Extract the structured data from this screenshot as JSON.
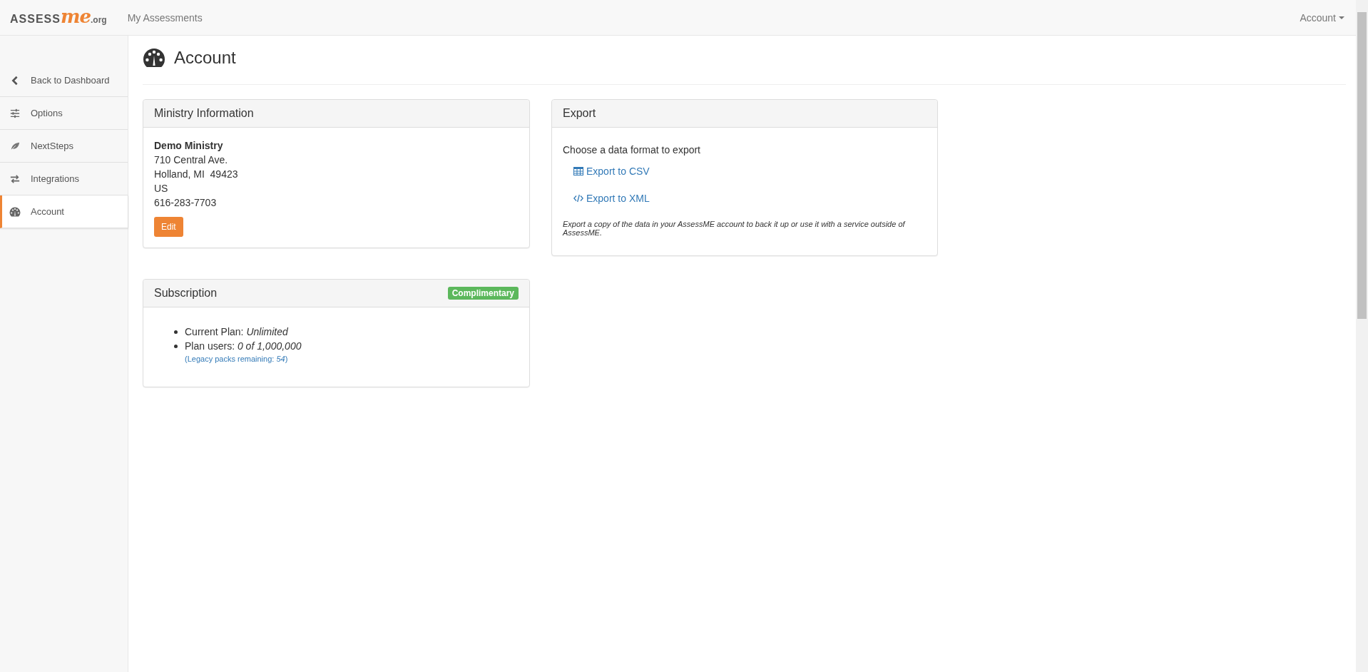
{
  "navbar": {
    "logo": {
      "part_1": "ASSESS",
      "part_2": "me",
      "part_3": ".org"
    },
    "links": [
      {
        "label": "My Assessments"
      }
    ],
    "account_menu": {
      "label": "Account"
    }
  },
  "sidebar": {
    "items": [
      {
        "label": "Back to Dashboard",
        "kind": "back",
        "selected": false
      },
      {
        "label": "Options",
        "kind": "options",
        "selected": false
      },
      {
        "label": "NextSteps",
        "kind": "nextsteps",
        "selected": false
      },
      {
        "label": "Integrations",
        "kind": "integrations",
        "selected": false
      },
      {
        "label": "Account",
        "kind": "account",
        "selected": true
      }
    ]
  },
  "page": {
    "title": "Account"
  },
  "ministry_panel": {
    "title": "Ministry Information",
    "name": "Demo Ministry",
    "address_lines": [
      "710 Central Ave.",
      "Holland, MI  49423",
      "US",
      "616-283-7703"
    ],
    "edit_button": "Edit"
  },
  "subscription_panel": {
    "title": "Subscription",
    "badge": "Complimentary",
    "items": [
      "Current Plan: *Unlimited*",
      "Plan users: *0 of 1,000,000*"
    ],
    "note": "(Legacy packs remaining: *54*)"
  },
  "export_panel": {
    "title": "Export",
    "intro": "Choose a data format to export",
    "links": [
      {
        "label": "Export to CSV",
        "kind": "csv"
      },
      {
        "label": "Export to XML",
        "kind": "xml"
      }
    ],
    "help": "Export a copy of the data in your AssessME account to back it up or use it with a service outside of AssessME."
  }
}
